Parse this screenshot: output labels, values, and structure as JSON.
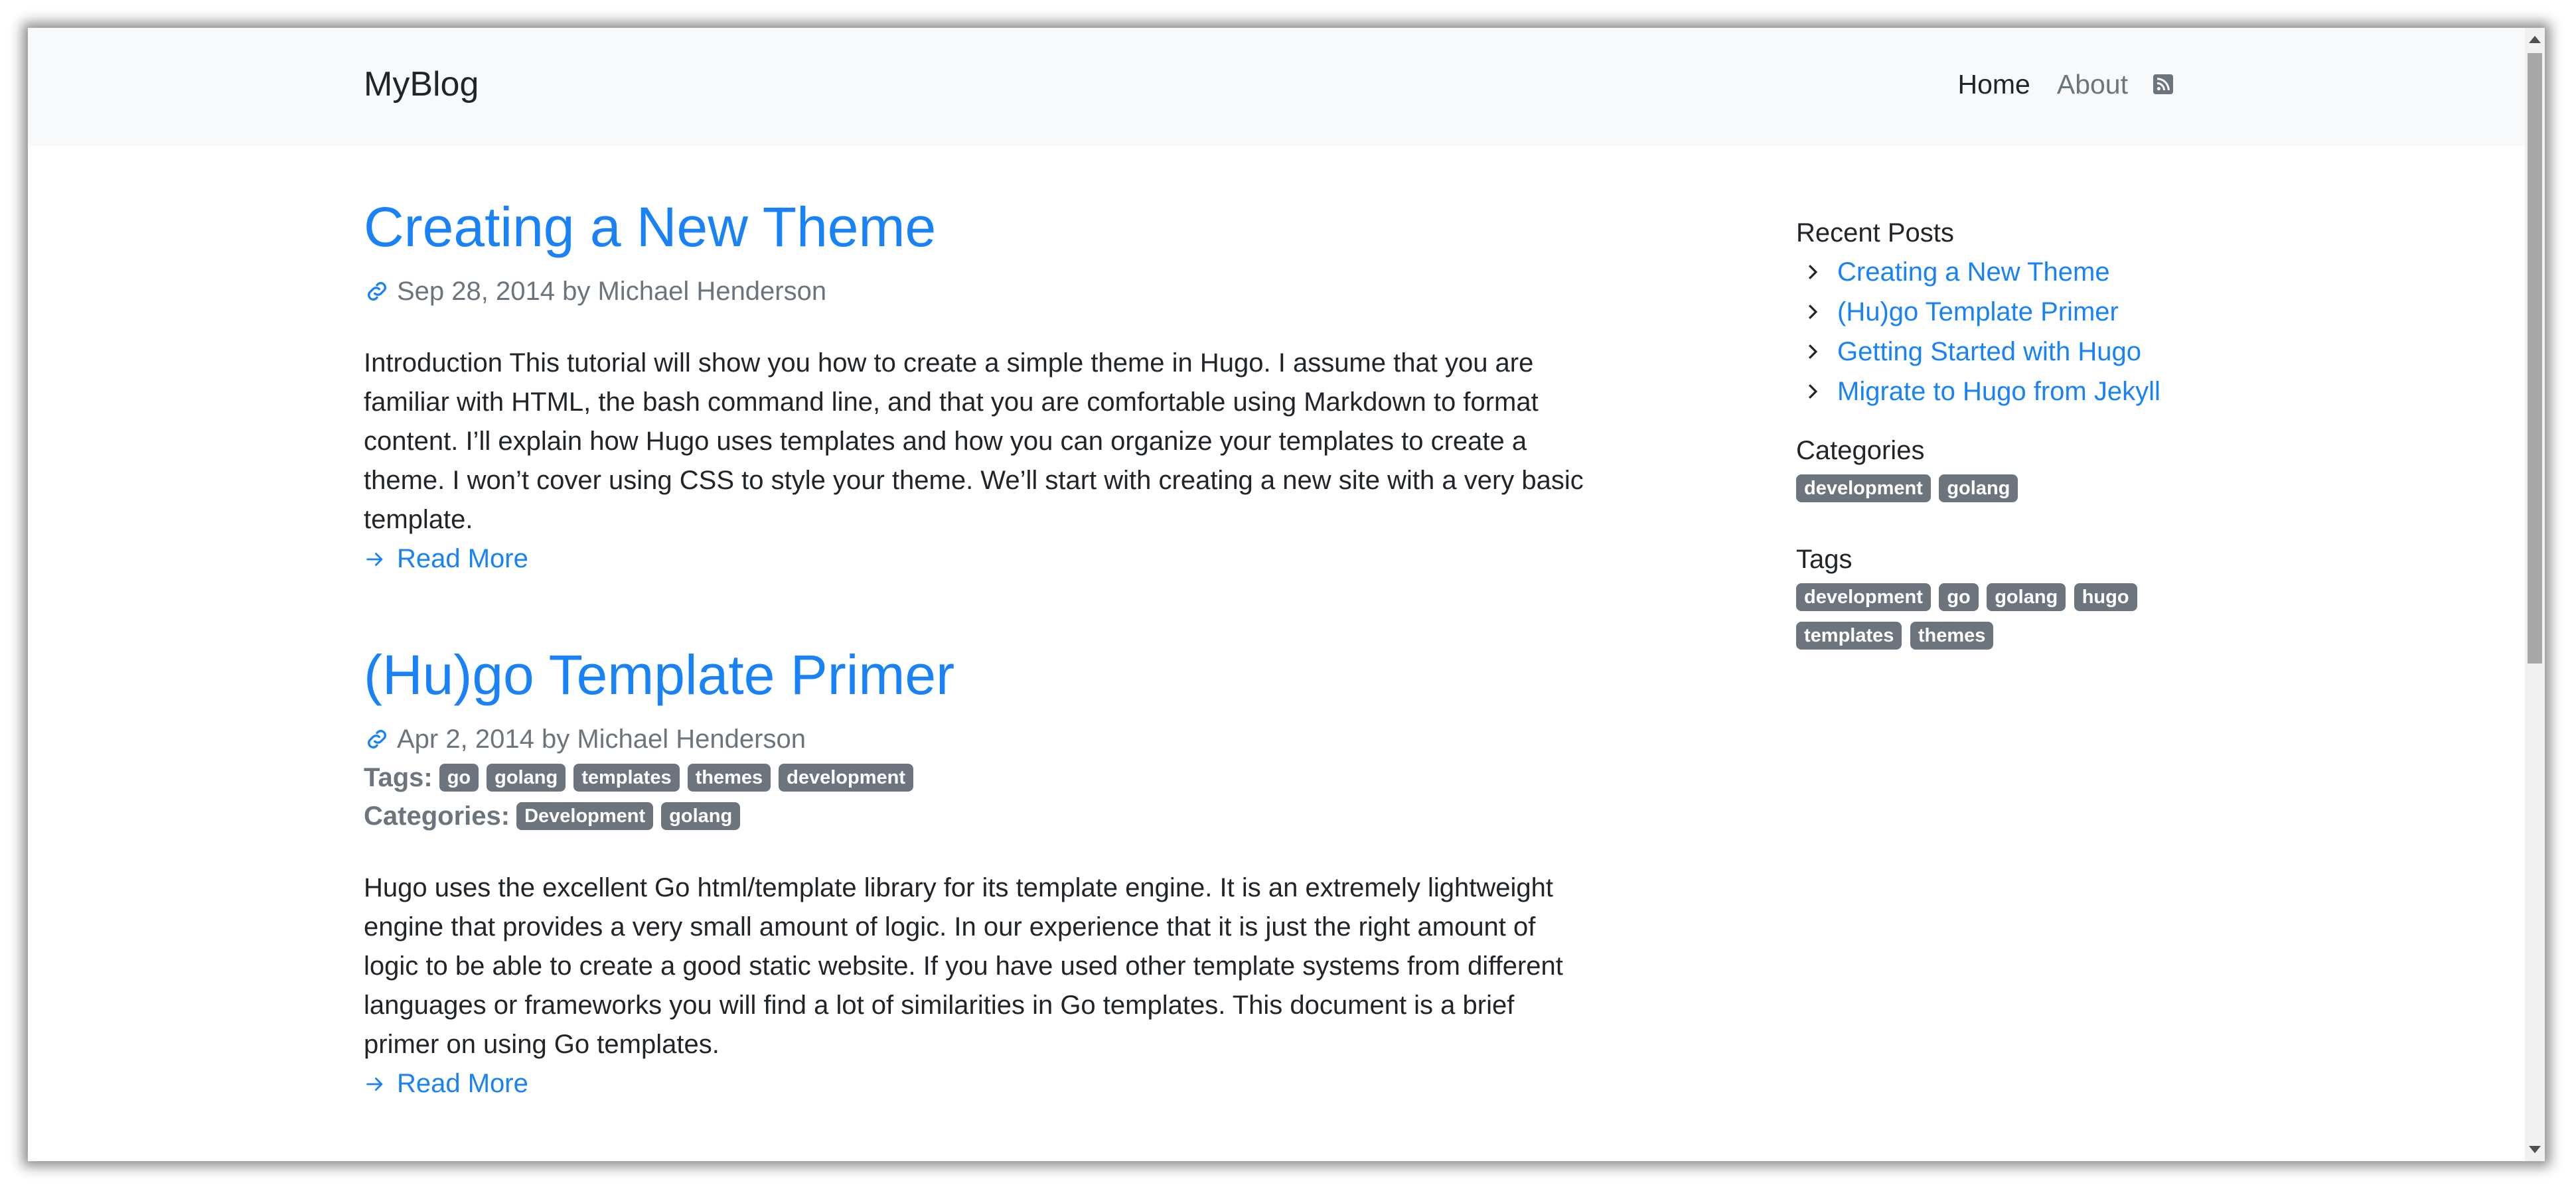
{
  "navbar": {
    "brand": "MyBlog",
    "links": [
      {
        "label": "Home",
        "active": true
      },
      {
        "label": "About",
        "active": false
      }
    ],
    "rss_icon": "rss-icon"
  },
  "posts": [
    {
      "title": "Creating a New Theme",
      "date": "Sep 28, 2014",
      "byline": "by Michael Henderson",
      "summary": "Introduction This tutorial will show you how to create a simple theme in Hugo. I assume that you are familiar with HTML, the bash command line, and that you are comfortable using Markdown to format content. I’ll explain how Hugo uses templates and how you can organize your templates to create a theme. I won’t cover using CSS to style your theme. We’ll start with creating a new site with a very basic template.",
      "read_more": "Read More"
    },
    {
      "title": "(Hu)go Template Primer",
      "date": "Apr 2, 2014",
      "byline": "by Michael Henderson",
      "tags_label": "Tags:",
      "tags": [
        "go",
        "golang",
        "templates",
        "themes",
        "development"
      ],
      "categories_label": "Categories:",
      "categories": [
        "Development",
        "golang"
      ],
      "summary": "Hugo uses the excellent Go html/template library for its template engine. It is an extremely lightweight engine that provides a very small amount of logic. In our experience that it is just the right amount of logic to be able to create a good static website. If you have used other template systems from different languages or frameworks you will find a lot of similarities in Go templates. This document is a brief primer on using Go templates.",
      "read_more": "Read More"
    }
  ],
  "sidebar": {
    "recent_heading": "Recent Posts",
    "recent_posts": [
      "Creating a New Theme",
      "(Hu)go Template Primer",
      "Getting Started with Hugo",
      "Migrate to Hugo from Jekyll"
    ],
    "categories_heading": "Categories",
    "categories": [
      "development",
      "golang"
    ],
    "tags_heading": "Tags",
    "tags": [
      "development",
      "go",
      "golang",
      "hugo",
      "templates",
      "themes"
    ]
  },
  "colors": {
    "link": "#1a82f7",
    "muted": "#6c757d",
    "text": "#212529",
    "navbar_bg": "#f8f9fa",
    "badge_bg": "#6c757d"
  }
}
